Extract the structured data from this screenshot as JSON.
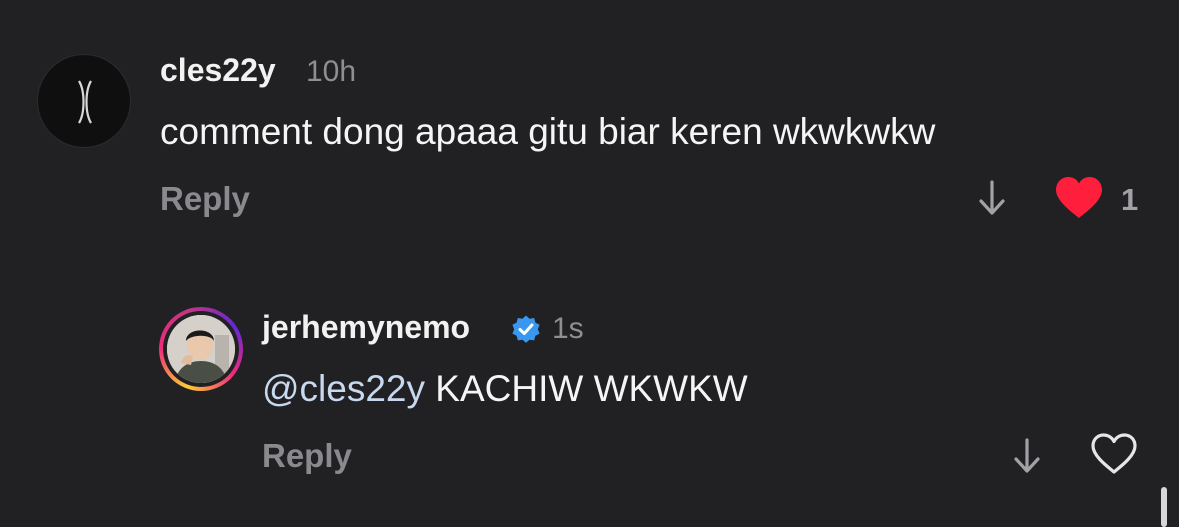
{
  "comments": [
    {
      "username": "cles22y",
      "time": "10h",
      "text": "comment dong apaaa gitu biar keren wkwkwkw",
      "reply_label": "Reply",
      "like_count": "1",
      "liked": true,
      "avatar_icon": "x-logo-avatar"
    },
    {
      "username": "jerhemynemo",
      "verified": true,
      "time": "1s",
      "mention": "@cles22y",
      "text": " KACHIW WKWKW",
      "reply_label": "Reply",
      "liked": false,
      "avatar_icon": "profile-photo-avatar"
    }
  ],
  "colors": {
    "background": "#212123",
    "like_red": "#ff1f3d",
    "verified_blue": "#3897f0",
    "muted_text": "#8a8a8e"
  }
}
